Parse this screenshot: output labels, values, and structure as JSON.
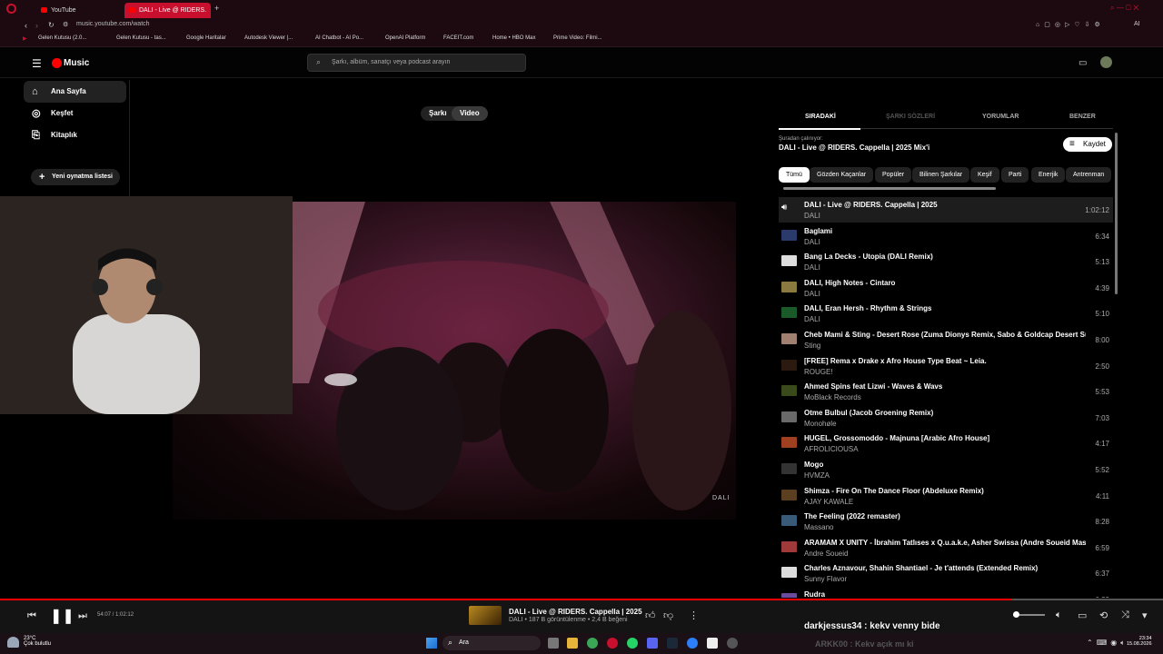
{
  "browser": {
    "tabs": [
      {
        "label": "YouTube"
      },
      {
        "label": "DALI - Live @ RIDERS."
      }
    ],
    "url": "music.youtube.com/watch",
    "bookmarks": [
      "Gelen Kutusu (2.0...",
      "Gelen Kutusu - tas...",
      "Google Haritalar",
      "Autodesk Viewer |...",
      "AI Chatbot - AI Po...",
      "OpenAI Platform",
      "FACEIT.com",
      "Home • HBO Max",
      "Prime Video: Filmi..."
    ]
  },
  "app": {
    "logo": "Music",
    "search_placeholder": "Şarkı, albüm, sanatçı veya podcast arayın"
  },
  "sidebar": {
    "items": [
      {
        "label": "Ana Sayfa",
        "icon": "home-icon",
        "active": true
      },
      {
        "label": "Keşfet",
        "icon": "compass-icon",
        "active": false
      },
      {
        "label": "Kitaplık",
        "icon": "library-icon",
        "active": false
      }
    ],
    "new_playlist": "Yeni oynatma listesi"
  },
  "toggle": {
    "song": "Şarkı",
    "video": "Video"
  },
  "video": {
    "watermark": "DALI"
  },
  "queue": {
    "tabs": [
      "SIRADAKİ",
      "ŞARKI SÖZLERİ",
      "YORUMLAR",
      "BENZER"
    ],
    "playing_from_label": "Şuradan çalınıyor:",
    "mix_title": "DALI - Live @ RIDERS. Cappella | 2025 Mix'i",
    "save_label": "Kaydet",
    "chips": [
      "Tümü",
      "Gözden Kaçanlar",
      "Popüler",
      "Bilinen Şarkılar",
      "Keşif",
      "Parti",
      "Enerjik",
      "Antrenman"
    ],
    "rows": [
      {
        "title": "DALI - Live @ RIDERS. Cappella | 2025",
        "artist": "DALI",
        "duration": "1:02:12",
        "current": true
      },
      {
        "title": "Baglami",
        "artist": "DALI",
        "duration": "6:34"
      },
      {
        "title": "Bang La Decks - Utopia (DALI Remix)",
        "artist": "DALI",
        "duration": "5:13"
      },
      {
        "title": "DALI, High Notes - Cintaro",
        "artist": "DALI",
        "duration": "4:39"
      },
      {
        "title": "DALI, Eran Hersh - Rhythm & Strings",
        "artist": "DALI",
        "duration": "5:10"
      },
      {
        "title": "Cheb Mami & Sting - Desert Rose (Zuma Dionys Remix, Sabo & Goldcap Desert Sunri...",
        "artist": "Sting",
        "duration": "8:00"
      },
      {
        "title": "[FREE] Rema x Drake x Afro House Type Beat ~ Leia.",
        "artist": "ROUGE!",
        "duration": "2:50"
      },
      {
        "title": "Ahmed Spins feat Lizwi - Waves & Wavs",
        "artist": "MoBlack Records",
        "duration": "5:53"
      },
      {
        "title": "Otme Bulbul (Jacob Groening Remix)",
        "artist": "Monohøle",
        "duration": "7:03"
      },
      {
        "title": "HUGEL, Grossomoddo - Majnuna [Arabic Afro House]",
        "artist": "AFROLICIOUSA",
        "duration": "4:17"
      },
      {
        "title": "Mogo",
        "artist": "HVMZA",
        "duration": "5:52"
      },
      {
        "title": "Shimza - Fire On The Dance Floor (Abdeluxe Remix)",
        "artist": "AJAY KAWALE",
        "duration": "4:11"
      },
      {
        "title": "The Feeling (2022 remaster)",
        "artist": "Massano",
        "duration": "8:28"
      },
      {
        "title": "ARAMAM X UNITY - İbrahim Tatlıses x Q.u.a.k.e, Asher Swissa (Andre Soueid Mashu...",
        "artist": "Andre Soueid",
        "duration": "6:59"
      },
      {
        "title": "Charles Aznavour, Shahin Shantiael - Je t'attends (Extended Remix)",
        "artist": "Sunny Flavor",
        "duration": "6:37"
      },
      {
        "title": "Rudra",
        "artist": "",
        "duration": "6:33"
      }
    ]
  },
  "player": {
    "time": "54:07 / 1:02:12",
    "progress": 0.87,
    "title": "DALI - Live @ RIDERS. Cappella | 2025",
    "subtitle": "DALI • 187 B görüntülenme • 2,4 B beğeni"
  },
  "overlay": {
    "chat1": "darkjessus34 : kekv venny bide",
    "chat2": "ARKK00 : Kekv açık mı ki"
  },
  "taskbar": {
    "weather_temp": "23°C",
    "weather_desc": "Çok bulutlu",
    "search": "Ara",
    "time": "23:34",
    "date": "15.08.2026"
  },
  "colors": {
    "accent": "#ff0000",
    "tab_active": "#c8102e",
    "chrome_bg": "#1c0a10"
  }
}
